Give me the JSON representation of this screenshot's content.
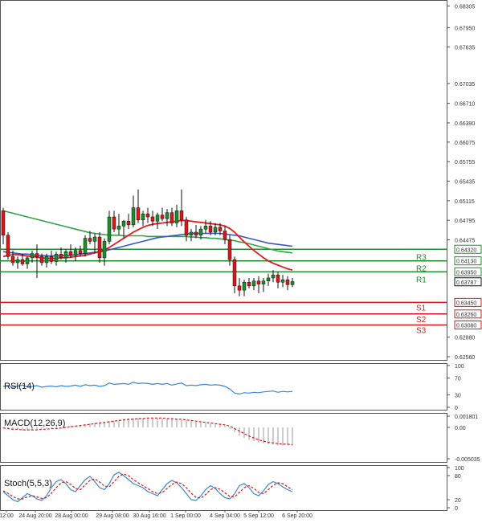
{
  "chart_data": [
    {
      "panel": "price",
      "type": "candlestick",
      "y_ticks": [
        "0.68305",
        "0.67950",
        "0.67635",
        "0.67035",
        "0.66710",
        "0.66390",
        "0.66075",
        "0.65755",
        "0.65435",
        "0.65115",
        "0.64795",
        "0.64475",
        "0.64320",
        "0.64130",
        "0.63950",
        "0.63787",
        "0.63450",
        "0.63260",
        "0.63080",
        "0.62880",
        "0.62560"
      ],
      "y_tick_values": [
        0.68305,
        0.6795,
        0.67635,
        0.67035,
        0.6671,
        0.6639,
        0.66075,
        0.65755,
        0.65435,
        0.65115,
        0.64795,
        0.64475
      ],
      "ylim": [
        0.6256,
        0.6835
      ],
      "x_ticks": [
        "12:00",
        "24 Aug 20:00",
        "28 Aug 00:00",
        "29 Aug 08:00",
        "30 Aug 16:00",
        "1 Sep 00:00",
        "4 Sep 04:00",
        "5 Sep 12:00",
        "6 Sep 20:00"
      ],
      "candles": [
        {
          "o": 0.6495,
          "h": 0.65,
          "l": 0.644,
          "c": 0.6455
        },
        {
          "o": 0.6455,
          "h": 0.646,
          "l": 0.6415,
          "c": 0.642
        },
        {
          "o": 0.642,
          "h": 0.643,
          "l": 0.6405,
          "c": 0.641
        },
        {
          "o": 0.641,
          "h": 0.642,
          "l": 0.64,
          "c": 0.6415
        },
        {
          "o": 0.6415,
          "h": 0.6425,
          "l": 0.6405,
          "c": 0.6408
        },
        {
          "o": 0.6408,
          "h": 0.642,
          "l": 0.64,
          "c": 0.6418
        },
        {
          "o": 0.6418,
          "h": 0.643,
          "l": 0.641,
          "c": 0.6425
        },
        {
          "o": 0.6425,
          "h": 0.644,
          "l": 0.6385,
          "c": 0.642
        },
        {
          "o": 0.642,
          "h": 0.6425,
          "l": 0.6405,
          "c": 0.641
        },
        {
          "o": 0.641,
          "h": 0.6425,
          "l": 0.6402,
          "c": 0.642
        },
        {
          "o": 0.642,
          "h": 0.643,
          "l": 0.6408,
          "c": 0.6412
        },
        {
          "o": 0.6412,
          "h": 0.6428,
          "l": 0.6405,
          "c": 0.6424
        },
        {
          "o": 0.6424,
          "h": 0.6435,
          "l": 0.6415,
          "c": 0.6418
        },
        {
          "o": 0.6418,
          "h": 0.6432,
          "l": 0.641,
          "c": 0.6428
        },
        {
          "o": 0.6428,
          "h": 0.644,
          "l": 0.6418,
          "c": 0.6422
        },
        {
          "o": 0.6422,
          "h": 0.6435,
          "l": 0.6412,
          "c": 0.643
        },
        {
          "o": 0.643,
          "h": 0.6438,
          "l": 0.642,
          "c": 0.6425
        },
        {
          "o": 0.6425,
          "h": 0.6455,
          "l": 0.642,
          "c": 0.645
        },
        {
          "o": 0.645,
          "h": 0.6462,
          "l": 0.644,
          "c": 0.6445
        },
        {
          "o": 0.6445,
          "h": 0.6458,
          "l": 0.6425,
          "c": 0.6452
        },
        {
          "o": 0.6452,
          "h": 0.646,
          "l": 0.641,
          "c": 0.6418
        },
        {
          "o": 0.6418,
          "h": 0.645,
          "l": 0.6405,
          "c": 0.6445
        },
        {
          "o": 0.6445,
          "h": 0.6495,
          "l": 0.644,
          "c": 0.6485
        },
        {
          "o": 0.6485,
          "h": 0.6495,
          "l": 0.646,
          "c": 0.6465
        },
        {
          "o": 0.6465,
          "h": 0.649,
          "l": 0.6455,
          "c": 0.647
        },
        {
          "o": 0.647,
          "h": 0.648,
          "l": 0.645,
          "c": 0.6478
        },
        {
          "o": 0.6478,
          "h": 0.649,
          "l": 0.6465,
          "c": 0.6472
        },
        {
          "o": 0.6472,
          "h": 0.652,
          "l": 0.6468,
          "c": 0.65
        },
        {
          "o": 0.65,
          "h": 0.653,
          "l": 0.6475,
          "c": 0.648
        },
        {
          "o": 0.648,
          "h": 0.6495,
          "l": 0.647,
          "c": 0.649
        },
        {
          "o": 0.649,
          "h": 0.65,
          "l": 0.6475,
          "c": 0.6485
        },
        {
          "o": 0.6485,
          "h": 0.6495,
          "l": 0.647,
          "c": 0.6478
        },
        {
          "o": 0.6478,
          "h": 0.6492,
          "l": 0.6465,
          "c": 0.6488
        },
        {
          "o": 0.6488,
          "h": 0.65,
          "l": 0.6478,
          "c": 0.6482
        },
        {
          "o": 0.6482,
          "h": 0.6498,
          "l": 0.647,
          "c": 0.6492
        },
        {
          "o": 0.6492,
          "h": 0.65,
          "l": 0.647,
          "c": 0.6475
        },
        {
          "o": 0.6475,
          "h": 0.6505,
          "l": 0.6468,
          "c": 0.6495
        },
        {
          "o": 0.6495,
          "h": 0.653,
          "l": 0.647,
          "c": 0.648
        },
        {
          "o": 0.648,
          "h": 0.6485,
          "l": 0.6445,
          "c": 0.6455
        },
        {
          "o": 0.6455,
          "h": 0.6465,
          "l": 0.6445,
          "c": 0.646
        },
        {
          "o": 0.646,
          "h": 0.6472,
          "l": 0.645,
          "c": 0.6455
        },
        {
          "o": 0.6455,
          "h": 0.647,
          "l": 0.6448,
          "c": 0.6465
        },
        {
          "o": 0.6465,
          "h": 0.648,
          "l": 0.6458,
          "c": 0.647
        },
        {
          "o": 0.647,
          "h": 0.6478,
          "l": 0.6455,
          "c": 0.646
        },
        {
          "o": 0.646,
          "h": 0.6475,
          "l": 0.6455,
          "c": 0.6468
        },
        {
          "o": 0.6468,
          "h": 0.6475,
          "l": 0.6455,
          "c": 0.6462
        },
        {
          "o": 0.6462,
          "h": 0.647,
          "l": 0.644,
          "c": 0.6448
        },
        {
          "o": 0.6448,
          "h": 0.6455,
          "l": 0.6405,
          "c": 0.6415
        },
        {
          "o": 0.6415,
          "h": 0.642,
          "l": 0.636,
          "c": 0.6372
        },
        {
          "o": 0.6372,
          "h": 0.6385,
          "l": 0.6355,
          "c": 0.6365
        },
        {
          "o": 0.6365,
          "h": 0.6382,
          "l": 0.6355,
          "c": 0.6378
        },
        {
          "o": 0.6378,
          "h": 0.6385,
          "l": 0.6368,
          "c": 0.6372
        },
        {
          "o": 0.6372,
          "h": 0.6385,
          "l": 0.6365,
          "c": 0.638
        },
        {
          "o": 0.638,
          "h": 0.6388,
          "l": 0.636,
          "c": 0.6375
        },
        {
          "o": 0.6375,
          "h": 0.6385,
          "l": 0.6362,
          "c": 0.638
        },
        {
          "o": 0.638,
          "h": 0.6392,
          "l": 0.6372,
          "c": 0.6385
        },
        {
          "o": 0.6385,
          "h": 0.6398,
          "l": 0.6378,
          "c": 0.639
        },
        {
          "o": 0.639,
          "h": 0.6395,
          "l": 0.6368,
          "c": 0.6378
        },
        {
          "o": 0.6378,
          "h": 0.639,
          "l": 0.637,
          "c": 0.6382
        },
        {
          "o": 0.6382,
          "h": 0.6388,
          "l": 0.6365,
          "c": 0.6374
        },
        {
          "o": 0.6374,
          "h": 0.6385,
          "l": 0.637,
          "c": 0.6379
        }
      ],
      "green_ma": [
        0.6495,
        0.6493,
        0.6491,
        0.6489,
        0.6487,
        0.6485,
        0.6483,
        0.6481,
        0.6479,
        0.6477,
        0.6475,
        0.6473,
        0.6471,
        0.6469,
        0.6467,
        0.6465,
        0.6463,
        0.6461,
        0.6459,
        0.6458,
        0.6457,
        0.6456,
        0.6455,
        0.6455,
        0.6455,
        0.6454,
        0.6454,
        0.6454,
        0.6454,
        0.6454,
        0.6453,
        0.6453,
        0.6453,
        0.6453,
        0.6453,
        0.6453,
        0.6453,
        0.6453,
        0.6453,
        0.6452,
        0.6452,
        0.6451,
        0.6451,
        0.645,
        0.645,
        0.6449,
        0.6448,
        0.6447,
        0.6446,
        0.6444,
        0.6443,
        0.6441,
        0.6439,
        0.6437,
        0.6435,
        0.6433,
        0.6431,
        0.6429,
        0.6428,
        0.6427,
        0.6426
      ],
      "blue_ma": [
        0.6428,
        0.6427,
        0.6426,
        0.6425,
        0.6424,
        0.6424,
        0.6423,
        0.6422,
        0.6422,
        0.6421,
        0.6421,
        0.6421,
        0.6421,
        0.6422,
        0.6422,
        0.6423,
        0.6424,
        0.6425,
        0.6426,
        0.6427,
        0.6428,
        0.6429,
        0.6431,
        0.6433,
        0.6435,
        0.6437,
        0.6439,
        0.6441,
        0.6443,
        0.6445,
        0.6447,
        0.6449,
        0.6451,
        0.6452,
        0.6453,
        0.6454,
        0.6455,
        0.6456,
        0.6457,
        0.6458,
        0.6458,
        0.6458,
        0.6458,
        0.6458,
        0.6458,
        0.6458,
        0.6457,
        0.6456,
        0.6455,
        0.6454,
        0.6452,
        0.645,
        0.6448,
        0.6446,
        0.6444,
        0.6442,
        0.6441,
        0.644,
        0.6439,
        0.6438,
        0.6437
      ],
      "red_ma": [
        0.642,
        0.6422,
        0.6423,
        0.6423,
        0.6422,
        0.6421,
        0.642,
        0.6419,
        0.6418,
        0.6417,
        0.6417,
        0.6417,
        0.6418,
        0.6418,
        0.6419,
        0.642,
        0.6421,
        0.6422,
        0.6424,
        0.6426,
        0.6428,
        0.6431,
        0.6435,
        0.644,
        0.6445,
        0.645,
        0.6455,
        0.646,
        0.6464,
        0.6468,
        0.6471,
        0.6473,
        0.6474,
        0.6475,
        0.6476,
        0.6477,
        0.6478,
        0.6479,
        0.6479,
        0.6478,
        0.6477,
        0.6476,
        0.6475,
        0.6474,
        0.6473,
        0.6472,
        0.647,
        0.6466,
        0.646,
        0.6452,
        0.6444,
        0.6437,
        0.643,
        0.6424,
        0.6418,
        0.6413,
        0.6409,
        0.6406,
        0.6403,
        0.64,
        0.6398
      ],
      "levels": [
        {
          "label": "R3",
          "value": 0.6432,
          "tag": "0.64320",
          "color": "#1e8c2a"
        },
        {
          "label": "R2",
          "value": 0.6413,
          "tag": "0.64130",
          "color": "#1e8c2a"
        },
        {
          "label": "R1",
          "value": 0.6395,
          "tag": "0.63950",
          "color": "#1e8c2a"
        },
        {
          "label": "S1",
          "value": 0.6345,
          "tag": "0.63450",
          "color": "#d81818"
        },
        {
          "label": "S2",
          "value": 0.6326,
          "tag": "0.63260",
          "color": "#d81818"
        },
        {
          "label": "S3",
          "value": 0.6308,
          "tag": "0.63080",
          "color": "#d81818"
        }
      ],
      "last_price": "0.63787",
      "colors": {
        "up": "#1e8c2a",
        "down": "#d81818",
        "green_ma": "#2ea34a",
        "blue_ma": "#3b55c8",
        "red_ma": "#e01c1c"
      }
    },
    {
      "panel": "rsi",
      "type": "line",
      "title": "RSI(14)",
      "y_ticks": [
        "100",
        "70",
        "30",
        "0"
      ],
      "ylim": [
        0,
        100
      ],
      "values": [
        50,
        52,
        48,
        51,
        53,
        49,
        50,
        52,
        48,
        50,
        51,
        49,
        52,
        50,
        51,
        53,
        50,
        54,
        52,
        53,
        50,
        52,
        58,
        55,
        56,
        57,
        55,
        60,
        57,
        58,
        57,
        55,
        57,
        55,
        57,
        53,
        56,
        58,
        52,
        53,
        52,
        54,
        55,
        53,
        54,
        53,
        50,
        44,
        34,
        32,
        35,
        34,
        36,
        35,
        37,
        38,
        39,
        36,
        38,
        37,
        38
      ],
      "color": "#3a86d4"
    },
    {
      "panel": "macd",
      "type": "bar+line",
      "title": "MACD(12,26,9)",
      "y_ticks": [
        "0.001801",
        "0.00",
        "-0.005035"
      ],
      "ylim": [
        -0.005035,
        0.001801
      ],
      "hist": [
        -0.0002,
        -0.0003,
        -0.0004,
        -0.0004,
        -0.0005,
        -0.0005,
        -0.0004,
        -0.0003,
        -0.0002,
        -0.0002,
        -0.0001,
        -0.0001,
        0.0,
        0.0001,
        0.0002,
        0.0003,
        0.0004,
        0.0005,
        0.0006,
        0.0007,
        0.0008,
        0.0009,
        0.001,
        0.0011,
        0.0012,
        0.0013,
        0.0014,
        0.0015,
        0.0015,
        0.0015,
        0.0015,
        0.0015,
        0.0015,
        0.0014,
        0.0014,
        0.0013,
        0.0013,
        0.0012,
        0.0011,
        0.001,
        0.0009,
        0.0008,
        0.0007,
        0.0006,
        0.0005,
        0.0004,
        0.0002,
        -0.0002,
        -0.0008,
        -0.0013,
        -0.0017,
        -0.002,
        -0.0022,
        -0.0024,
        -0.0026,
        -0.0027,
        -0.0028,
        -0.0029,
        -0.0029,
        -0.0029,
        -0.0029
      ],
      "signal": [
        -0.0001,
        -0.0002,
        -0.0003,
        -0.0003,
        -0.0004,
        -0.0004,
        -0.0004,
        -0.0004,
        -0.0003,
        -0.0003,
        -0.0002,
        -0.0002,
        -0.0001,
        0.0,
        0.0001,
        0.0002,
        0.0003,
        0.0004,
        0.0005,
        0.0006,
        0.0007,
        0.0008,
        0.0009,
        0.001,
        0.0011,
        0.0012,
        0.0013,
        0.0013,
        0.0014,
        0.0014,
        0.0015,
        0.0015,
        0.0015,
        0.0015,
        0.0014,
        0.0014,
        0.0013,
        0.0013,
        0.0012,
        0.0011,
        0.001,
        0.0009,
        0.0008,
        0.0007,
        0.0006,
        0.0005,
        0.0004,
        0.0002,
        -0.0002,
        -0.0006,
        -0.001,
        -0.0014,
        -0.0017,
        -0.002,
        -0.0022,
        -0.0024,
        -0.0025,
        -0.0026,
        -0.0027,
        -0.0027,
        -0.0028
      ],
      "colors": {
        "hist": "#9a9a9a",
        "signal": "#d81818"
      }
    },
    {
      "panel": "stoch",
      "type": "line",
      "title": "Stoch(5,5,3)",
      "y_ticks": [
        "100",
        "80",
        "20",
        "0"
      ],
      "ylim": [
        0,
        100
      ],
      "k": [
        40,
        30,
        20,
        15,
        25,
        35,
        30,
        22,
        18,
        30,
        50,
        65,
        70,
        60,
        45,
        40,
        55,
        70,
        78,
        65,
        50,
        45,
        60,
        82,
        88,
        80,
        70,
        60,
        55,
        50,
        40,
        35,
        30,
        45,
        60,
        68,
        62,
        50,
        35,
        20,
        18,
        30,
        45,
        55,
        48,
        35,
        25,
        22,
        35,
        55,
        60,
        50,
        35,
        30,
        42,
        58,
        65,
        60,
        52,
        45,
        40
      ],
      "d": [
        42,
        36,
        28,
        22,
        22,
        27,
        30,
        27,
        23,
        25,
        36,
        50,
        62,
        65,
        58,
        48,
        45,
        57,
        68,
        72,
        64,
        54,
        52,
        65,
        78,
        84,
        80,
        70,
        62,
        55,
        48,
        40,
        35,
        38,
        48,
        58,
        64,
        60,
        50,
        36,
        26,
        24,
        33,
        45,
        50,
        46,
        37,
        28,
        27,
        38,
        50,
        55,
        48,
        38,
        35,
        45,
        56,
        62,
        60,
        52,
        45
      ],
      "colors": {
        "k": "#3a86d4",
        "d": "#d81818"
      }
    }
  ]
}
